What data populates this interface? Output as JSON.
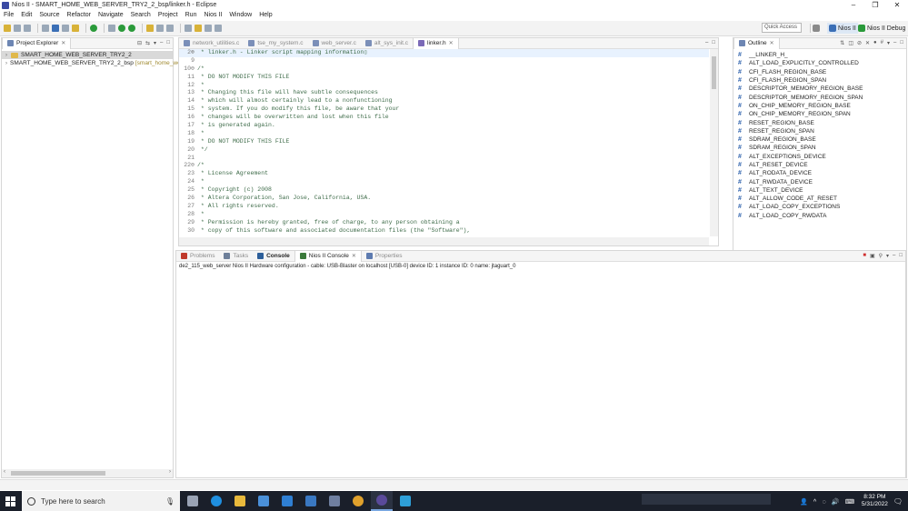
{
  "window": {
    "title": "Nios II - SMART_HOME_WEB_SERVER_TRY2_2_bsp/linker.h - Eclipse",
    "controls": [
      "–",
      "❐",
      "✕"
    ]
  },
  "menu": [
    "File",
    "Edit",
    "Source",
    "Refactor",
    "Navigate",
    "Search",
    "Project",
    "Run",
    "Nios II",
    "Window",
    "Help"
  ],
  "toolbar": {
    "quick_access_placeholder": "Quick Access",
    "perspectives": [
      {
        "label": "Nios II",
        "active": true
      },
      {
        "label": "Nios II Debug",
        "active": false
      }
    ]
  },
  "project_explorer": {
    "title": "Project Explorer",
    "items": [
      {
        "label": "SMART_HOME_WEB_SERVER_TRY2_2",
        "extra": "",
        "selected": true
      },
      {
        "label": "SMART_HOME_WEB_SERVER_TRY2_2_bsp",
        "extra": "[smart_home_web",
        "selected": false
      }
    ]
  },
  "editor": {
    "tabs": [
      {
        "label": "network_utilities.c",
        "active": false
      },
      {
        "label": "tse_my_system.c",
        "active": false
      },
      {
        "label": "web_server.c",
        "active": false
      },
      {
        "label": "alt_sys_init.c",
        "active": false
      },
      {
        "label": "linker.h",
        "active": true
      }
    ],
    "lines": [
      {
        "n": "2⊕",
        "text": " * linker.h - Linker script mapping information▯",
        "current": true
      },
      {
        "n": "9",
        "text": "",
        "current": false
      },
      {
        "n": "10⊖",
        "text": "/*",
        "current": false
      },
      {
        "n": "11",
        "text": " * DO NOT MODIFY THIS FILE",
        "current": false
      },
      {
        "n": "12",
        "text": " *",
        "current": false
      },
      {
        "n": "13",
        "text": " * Changing this file will have subtle consequences",
        "current": false
      },
      {
        "n": "14",
        "text": " * which will almost certainly lead to a nonfunctioning",
        "current": false
      },
      {
        "n": "15",
        "text": " * system. If you do modify this file, be aware that your",
        "current": false
      },
      {
        "n": "16",
        "text": " * changes will be overwritten and lost when this file",
        "current": false
      },
      {
        "n": "17",
        "text": " * is generated again.",
        "current": false
      },
      {
        "n": "18",
        "text": " *",
        "current": false
      },
      {
        "n": "19",
        "text": " * DO NOT MODIFY THIS FILE",
        "current": false
      },
      {
        "n": "20",
        "text": " */",
        "current": false
      },
      {
        "n": "21",
        "text": "",
        "current": false
      },
      {
        "n": "22⊖",
        "text": "/*",
        "current": false
      },
      {
        "n": "23",
        "text": " * License Agreement",
        "current": false
      },
      {
        "n": "24",
        "text": " *",
        "current": false
      },
      {
        "n": "25",
        "text": " * Copyright (c) 2008",
        "current": false
      },
      {
        "n": "26",
        "text": " * Altera Corporation, San Jose, California, USA.",
        "current": false
      },
      {
        "n": "27",
        "text": " * All rights reserved.",
        "current": false
      },
      {
        "n": "28",
        "text": " *",
        "current": false
      },
      {
        "n": "29",
        "text": " * Permission is hereby granted, free of charge, to any person obtaining a",
        "current": false
      },
      {
        "n": "30",
        "text": " * copy of this software and associated documentation files (the \"Software\"),",
        "current": false
      }
    ]
  },
  "outline": {
    "title": "Outline",
    "items": [
      "__LINKER_H_",
      "ALT_LOAD_EXPLICITLY_CONTROLLED",
      "CFI_FLASH_REGION_BASE",
      "CFI_FLASH_REGION_SPAN",
      "DESCRIPTOR_MEMORY_REGION_BASE",
      "DESCRIPTOR_MEMORY_REGION_SPAN",
      "ON_CHIP_MEMORY_REGION_BASE",
      "ON_CHIP_MEMORY_REGION_SPAN",
      "RESET_REGION_BASE",
      "RESET_REGION_SPAN",
      "SDRAM_REGION_BASE",
      "SDRAM_REGION_SPAN",
      "ALT_EXCEPTIONS_DEVICE",
      "ALT_RESET_DEVICE",
      "ALT_RODATA_DEVICE",
      "ALT_RWDATA_DEVICE",
      "ALT_TEXT_DEVICE",
      "ALT_ALLOW_CODE_AT_RESET",
      "ALT_LOAD_COPY_EXCEPTIONS",
      "ALT_LOAD_COPY_RWDATA"
    ]
  },
  "bottom_panel": {
    "tabs": [
      {
        "label": "Problems",
        "active": false,
        "color": "#c0392b"
      },
      {
        "label": "Tasks",
        "active": false,
        "color": "#6d7f99"
      },
      {
        "label": "Console",
        "active": false,
        "color": "#2d5f9a"
      },
      {
        "label": "Nios II Console",
        "active": true,
        "color": "#3b7a3b"
      },
      {
        "label": "Properties",
        "active": false,
        "color": "#5d7bb0"
      }
    ],
    "console_text": "de2_115_web_server Nios II Hardware configuration - cable: USB-Blaster on localhost [USB-0] device ID: 1 instance ID: 0 name: jtaguart_0"
  },
  "taskbar": {
    "search_placeholder": "Type here to search",
    "time": "8:32 PM",
    "date": "5/31/2022",
    "icons": [
      {
        "name": "task-view-icon",
        "color": "#9aa3b5"
      },
      {
        "name": "edge-icon",
        "color": "#1f8fe0"
      },
      {
        "name": "file-explorer-icon",
        "color": "#e8b93c"
      },
      {
        "name": "store-icon",
        "color": "#4a90d9"
      },
      {
        "name": "mail-icon",
        "color": "#2f7fd3"
      },
      {
        "name": "app-icon",
        "color": "#3a78c2"
      },
      {
        "name": "matlab-icon",
        "color": "#6f7fa0"
      },
      {
        "name": "chrome-icon",
        "color": "#e0a12c"
      },
      {
        "name": "eclipse-icon",
        "color": "#5a4a9a"
      },
      {
        "name": "quartus-icon",
        "color": "#2e9fd8"
      }
    ]
  }
}
